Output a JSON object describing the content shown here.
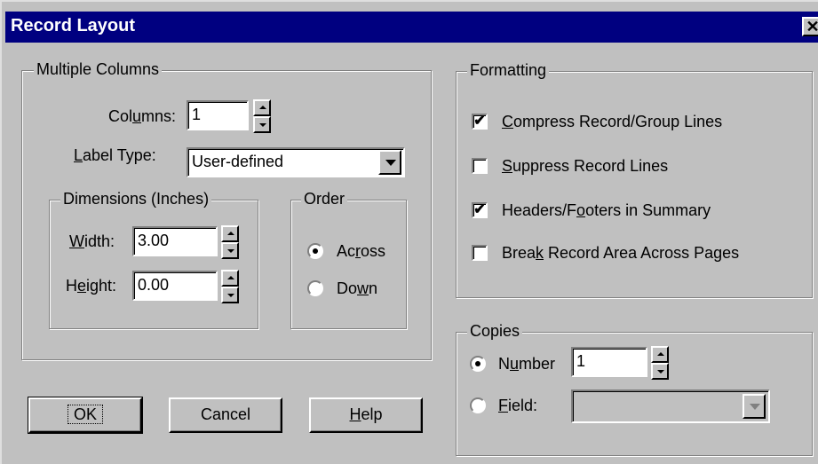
{
  "window": {
    "title": "Record Layout",
    "close_glyph": "✕"
  },
  "multiple_columns": {
    "legend": "Multiple Columns",
    "columns_label_pre": "Col",
    "columns_label_u": "u",
    "columns_label_post": "mns:",
    "columns_value": "1",
    "label_type_label_u": "L",
    "label_type_label_post": "abel Type:",
    "label_type_value": "User-defined",
    "dimensions": {
      "legend": "Dimensions (Inches)",
      "width_label_u": "W",
      "width_label_post": "idth:",
      "width_value": "3.00",
      "height_label_pre": "H",
      "height_label_u": "e",
      "height_label_post": "ight:",
      "height_value": "0.00"
    },
    "order": {
      "legend": "Order",
      "across_pre": "Ac",
      "across_u": "r",
      "across_post": "oss",
      "down_pre": "Do",
      "down_u": "w",
      "down_post": "n",
      "selected": "Across"
    }
  },
  "formatting": {
    "legend": "Formatting",
    "options": [
      {
        "u": "C",
        "post": "ompress Record/Group Lines",
        "checked": true,
        "mark": "✔"
      },
      {
        "u": "S",
        "post": "uppress Record Lines",
        "checked": false,
        "mark": ""
      },
      {
        "pre": "Headers/F",
        "u": "o",
        "post": "oters in Summary",
        "checked": true,
        "mark": "✔"
      },
      {
        "pre": "Brea",
        "u": "k",
        "post": " Record Area Across Pages",
        "checked": false,
        "mark": ""
      }
    ]
  },
  "copies": {
    "legend": "Copies",
    "number_pre": "N",
    "number_u": "u",
    "number_post": "mber",
    "number_value": "1",
    "field_u": "F",
    "field_post": "ield:",
    "field_value": "",
    "selected": "Number"
  },
  "buttons": {
    "ok": "OK",
    "cancel": "Cancel",
    "help_u": "H",
    "help_post": "elp"
  },
  "colors": {
    "face": "#c0c0c0",
    "title_bar": "#000080",
    "title_text": "#ffffff"
  }
}
